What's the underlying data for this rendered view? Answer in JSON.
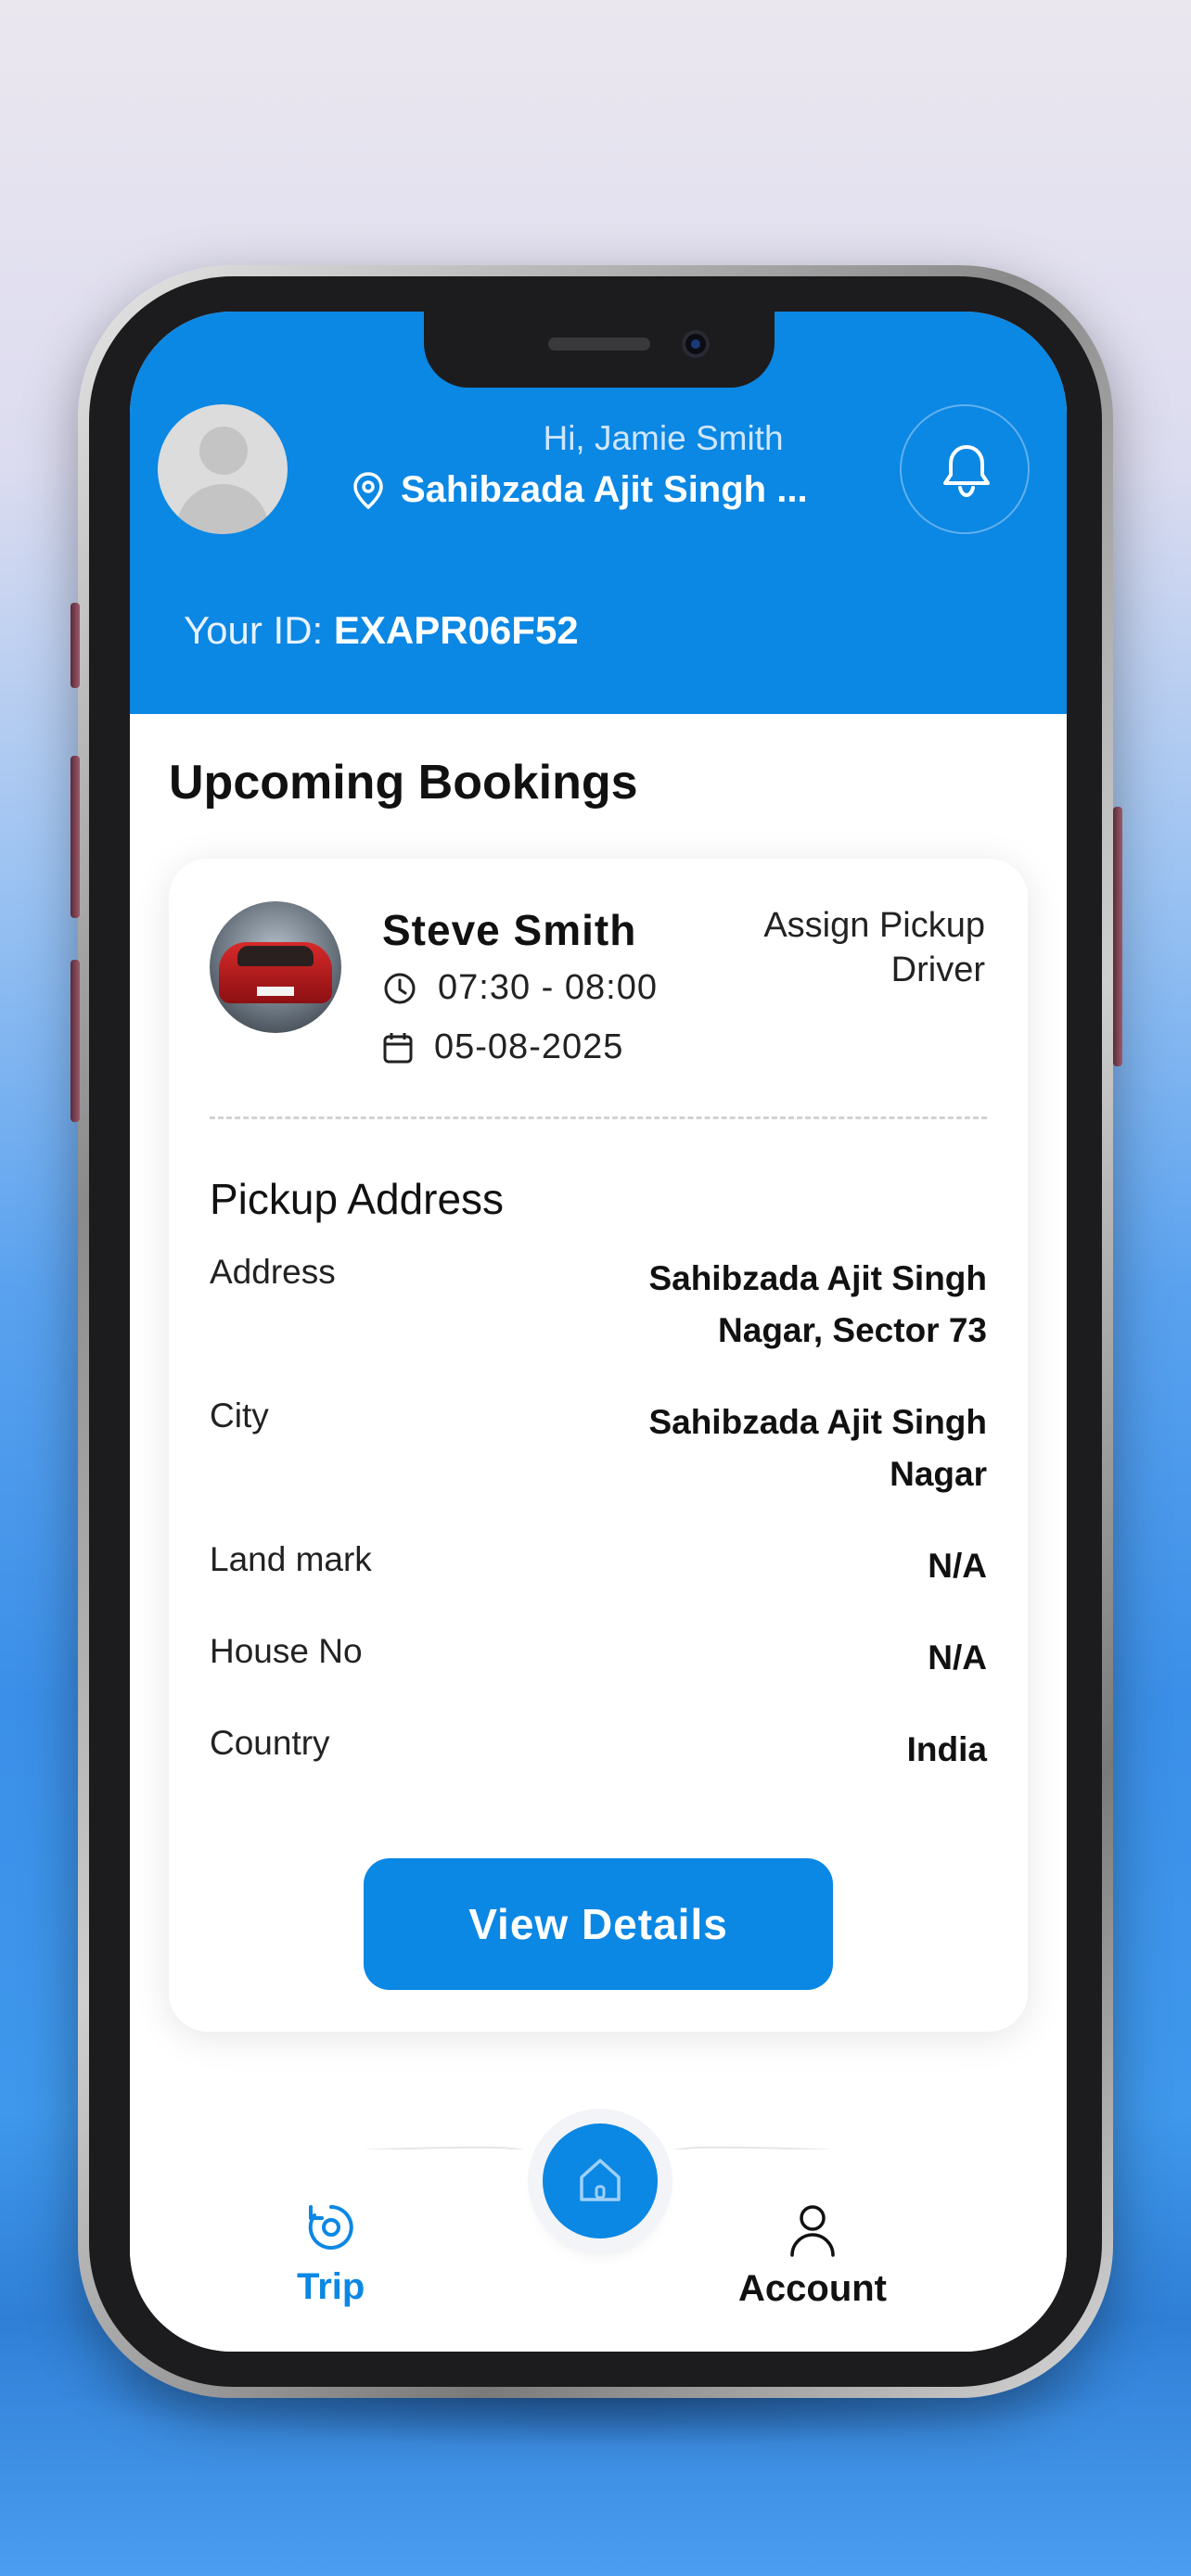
{
  "header": {
    "greeting": "Hi, Jamie Smith",
    "location": "Sahibzada Ajit Singh ...",
    "id_label": "Your ID:",
    "id_value": "EXAPR06F52"
  },
  "bookings": {
    "section_title": "Upcoming Bookings",
    "card": {
      "customer_name": "Steve Smith",
      "assign_label": "Assign Pickup Driver",
      "time": "07:30 - 08:00",
      "date": "05-08-2025",
      "pickup_title": "Pickup Address",
      "fields": [
        {
          "label": "Address",
          "value": "Sahibzada Ajit Singh Nagar, Sector 73"
        },
        {
          "label": "City",
          "value": "Sahibzada Ajit Singh Nagar"
        },
        {
          "label": "Land mark",
          "value": "N/A"
        },
        {
          "label": "House No",
          "value": "N/A"
        },
        {
          "label": "Country",
          "value": "India"
        }
      ],
      "button_label": "View Details"
    }
  },
  "nav": {
    "trip_label": "Trip",
    "account_label": "Account",
    "home_icon": "home-icon",
    "active": "Trip"
  },
  "colors": {
    "primary": "#0b87e4",
    "header_bg": "#0b87e4",
    "text": "#111111"
  }
}
